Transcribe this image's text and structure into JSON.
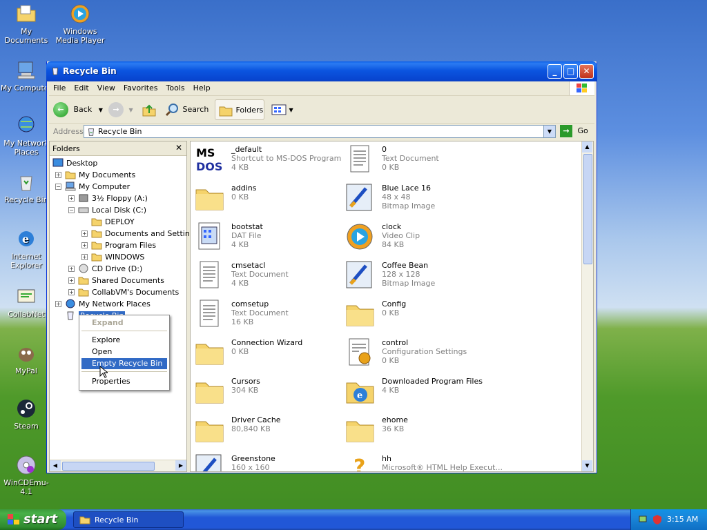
{
  "desktop": {
    "icons": [
      {
        "label": "My Documents"
      },
      {
        "label": "Windows Media Player"
      },
      {
        "label": "My Computer"
      },
      {
        "label": "My Network Places"
      },
      {
        "label": "Recycle Bin"
      },
      {
        "label": "Internet Explorer"
      },
      {
        "label": "CollabNet"
      },
      {
        "label": "MyPal"
      },
      {
        "label": "Steam"
      },
      {
        "label": "WinCDEmu-4.1"
      }
    ]
  },
  "window": {
    "title": "Recycle Bin",
    "menu": [
      "File",
      "Edit",
      "View",
      "Favorites",
      "Tools",
      "Help"
    ],
    "toolbar": {
      "back": "Back",
      "search": "Search",
      "folders": "Folders"
    },
    "address": {
      "label": "Address",
      "value": "Recycle Bin",
      "go": "Go"
    },
    "folders_pane": {
      "title": "Folders",
      "tree": [
        {
          "label": "Desktop"
        },
        {
          "label": "My Documents"
        },
        {
          "label": "My Computer"
        },
        {
          "label": "3½ Floppy (A:)"
        },
        {
          "label": "Local Disk (C:)"
        },
        {
          "label": "DEPLOY"
        },
        {
          "label": "Documents and Settings"
        },
        {
          "label": "Program Files"
        },
        {
          "label": "WINDOWS"
        },
        {
          "label": "CD Drive (D:)"
        },
        {
          "label": "Shared Documents"
        },
        {
          "label": "CollabVM's Documents"
        },
        {
          "label": "My Network Places"
        },
        {
          "label": "Recycle Bin"
        }
      ]
    },
    "items": [
      {
        "name": "_default",
        "l2": "Shortcut to MS-DOS Program",
        "l3": "4 KB",
        "icon": "msdos-icon"
      },
      {
        "name": "0",
        "l2": "Text Document",
        "l3": "0 KB",
        "icon": "text-document-icon"
      },
      {
        "name": "addins",
        "l2": "0 KB",
        "l3": "",
        "icon": "folder-icon"
      },
      {
        "name": "Blue Lace 16",
        "l2": "48 x 48",
        "l3": "Bitmap Image",
        "icon": "bitmap-icon"
      },
      {
        "name": "bootstat",
        "l2": "DAT File",
        "l3": "4 KB",
        "icon": "dat-file-icon"
      },
      {
        "name": "clock",
        "l2": "Video Clip",
        "l3": "84 KB",
        "icon": "video-clip-icon"
      },
      {
        "name": "cmsetacl",
        "l2": "Text Document",
        "l3": "4 KB",
        "icon": "text-document-icon"
      },
      {
        "name": "Coffee Bean",
        "l2": "128 x 128",
        "l3": "Bitmap Image",
        "icon": "bitmap-icon"
      },
      {
        "name": "comsetup",
        "l2": "Text Document",
        "l3": "16 KB",
        "icon": "text-document-icon"
      },
      {
        "name": "Config",
        "l2": "0 KB",
        "l3": "",
        "icon": "folder-icon"
      },
      {
        "name": "Connection Wizard",
        "l2": "0 KB",
        "l3": "",
        "icon": "folder-icon"
      },
      {
        "name": "control",
        "l2": "Configuration Settings",
        "l3": "0 KB",
        "icon": "config-settings-icon"
      },
      {
        "name": "Cursors",
        "l2": "304 KB",
        "l3": "",
        "icon": "folder-icon"
      },
      {
        "name": "Downloaded Program Files",
        "l2": "4 KB",
        "l3": "",
        "icon": "ie-folder-icon"
      },
      {
        "name": "Driver Cache",
        "l2": "80,840 KB",
        "l3": "",
        "icon": "folder-icon"
      },
      {
        "name": "ehome",
        "l2": "36 KB",
        "l3": "",
        "icon": "folder-icon"
      },
      {
        "name": "Greenstone",
        "l2": "160 x 160",
        "l3": "",
        "icon": "bitmap-icon"
      },
      {
        "name": "hh",
        "l2": "Microsoft® HTML Help Execut...",
        "l3": "",
        "icon": "help-icon"
      }
    ]
  },
  "context_menu": {
    "items": [
      "Expand",
      "Explore",
      "Open",
      "Empty Recycle Bin",
      "Properties"
    ]
  },
  "taskbar": {
    "start": "start",
    "task": "Recycle Bin",
    "clock": "3:15 AM"
  }
}
